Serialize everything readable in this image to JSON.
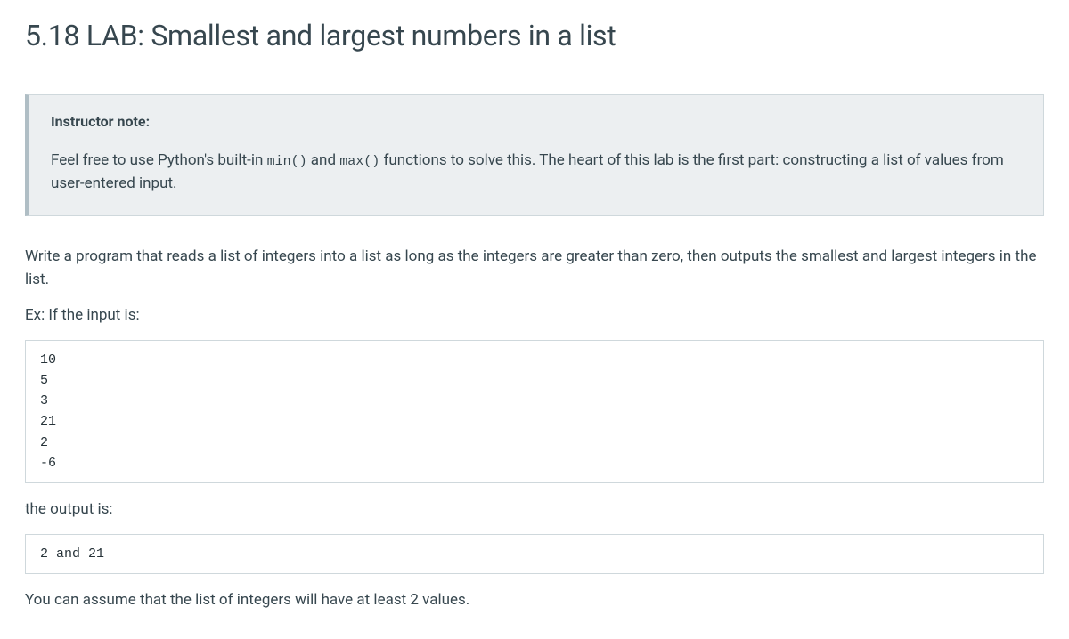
{
  "title": "5.18 LAB: Smallest and largest numbers in a list",
  "instructor_note": {
    "heading": "Instructor note:",
    "text_before_min": "Feel free to use Python's built-in ",
    "code_min": "min()",
    "text_between": " and ",
    "code_max": "max()",
    "text_after_max": " functions to solve this. The heart of this lab is the first part: constructing a list of values from user-entered input."
  },
  "paragraph1": "Write a program that reads a list of integers into a list as long as the integers are greater than zero, then outputs the smallest and largest integers in the list.",
  "example_intro": "Ex: If the input is:",
  "input_block": "10\n5\n3\n21\n2\n-6",
  "output_intro": "the output is:",
  "output_block": "2 and 21",
  "paragraph2": "You can assume that the list of integers will have at least 2 values."
}
